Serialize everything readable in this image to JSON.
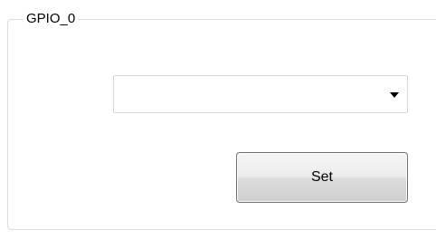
{
  "group": {
    "title": "GPIO_0"
  },
  "combo": {
    "selected_value": ""
  },
  "buttons": {
    "set_label": "Set"
  },
  "icons": {
    "dropdown_arrow": "chevron-down-icon"
  }
}
